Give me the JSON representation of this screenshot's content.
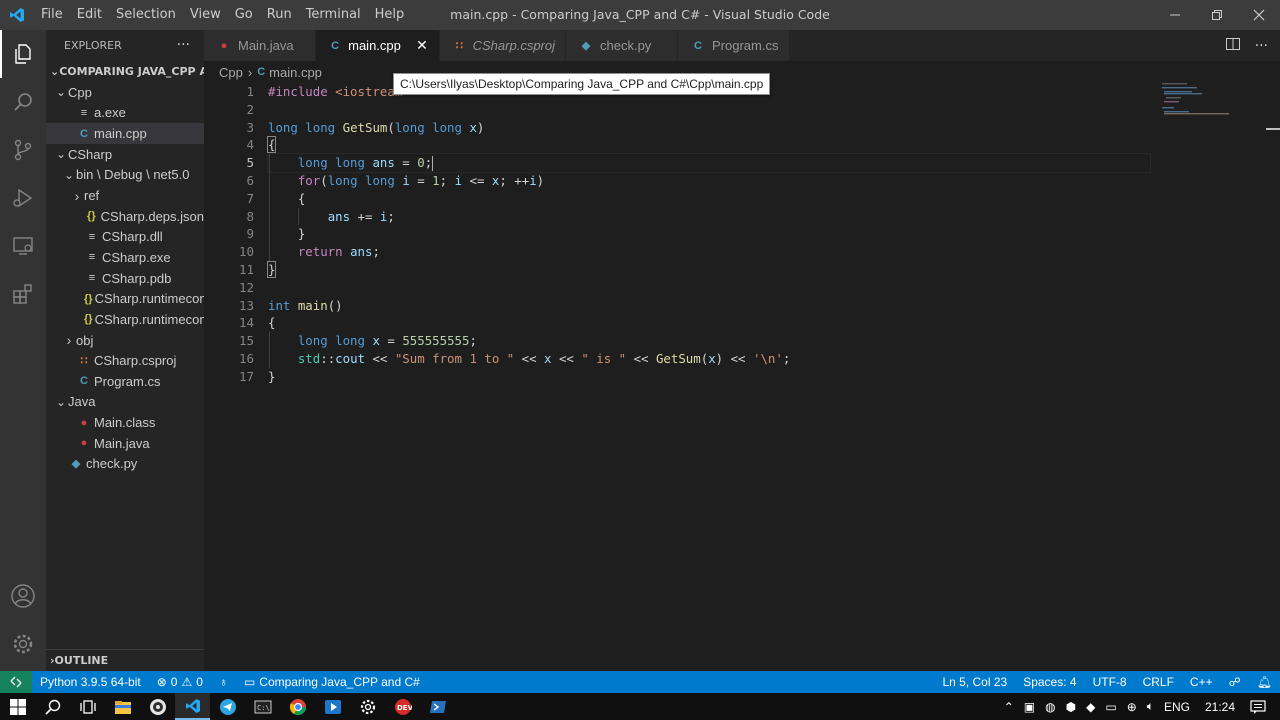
{
  "window": {
    "title": "main.cpp - Comparing Java_CPP and C# - Visual Studio Code",
    "menu": [
      "File",
      "Edit",
      "Selection",
      "View",
      "Go",
      "Run",
      "Terminal",
      "Help"
    ]
  },
  "explorer": {
    "header": "EXPLORER",
    "more_label": "···",
    "workspace": "COMPARING JAVA_CPP A...",
    "tree": [
      {
        "label": "Cpp",
        "depth": 1,
        "kind": "folder-open"
      },
      {
        "label": "a.exe",
        "depth": 2,
        "kind": "file",
        "icon": "lines"
      },
      {
        "label": "main.cpp",
        "depth": 2,
        "kind": "file",
        "icon": "cpp",
        "selected": true
      },
      {
        "label": "CSharp",
        "depth": 1,
        "kind": "folder-open"
      },
      {
        "label": "bin \\ Debug \\ net5.0",
        "depth": 2,
        "kind": "folder-open"
      },
      {
        "label": "ref",
        "depth": 3,
        "kind": "folder-closed"
      },
      {
        "label": "CSharp.deps.json",
        "depth": 3,
        "kind": "file",
        "icon": "json"
      },
      {
        "label": "CSharp.dll",
        "depth": 3,
        "kind": "file",
        "icon": "lines"
      },
      {
        "label": "CSharp.exe",
        "depth": 3,
        "kind": "file",
        "icon": "lines"
      },
      {
        "label": "CSharp.pdb",
        "depth": 3,
        "kind": "file",
        "icon": "lines"
      },
      {
        "label": "CSharp.runtimecon...",
        "depth": 3,
        "kind": "file",
        "icon": "json"
      },
      {
        "label": "CSharp.runtimecon...",
        "depth": 3,
        "kind": "file",
        "icon": "json"
      },
      {
        "label": "obj",
        "depth": 2,
        "kind": "folder-closed"
      },
      {
        "label": "CSharp.csproj",
        "depth": 2,
        "kind": "file",
        "icon": "rss"
      },
      {
        "label": "Program.cs",
        "depth": 2,
        "kind": "file",
        "icon": "cs"
      },
      {
        "label": "Java",
        "depth": 1,
        "kind": "folder-open"
      },
      {
        "label": "Main.class",
        "depth": 2,
        "kind": "file",
        "icon": "java"
      },
      {
        "label": "Main.java",
        "depth": 2,
        "kind": "file",
        "icon": "java"
      },
      {
        "label": "check.py",
        "depth": 1,
        "kind": "file",
        "icon": "py"
      }
    ],
    "outline": "OUTLINE"
  },
  "tabs": [
    {
      "label": "Main.java",
      "icon": "java"
    },
    {
      "label": "main.cpp",
      "icon": "cpp",
      "active": true,
      "close": "✕"
    },
    {
      "label": "CSharp.csproj",
      "icon": "rss",
      "italic": true
    },
    {
      "label": "check.py",
      "icon": "py"
    },
    {
      "label": "Program.cs",
      "icon": "cs"
    }
  ],
  "breadcrumb": {
    "folder": "Cpp",
    "file": "main.cpp"
  },
  "tooltip": "C:\\Users\\Ilyas\\Desktop\\Comparing Java_CPP and C#\\Cpp\\main.cpp",
  "editor": {
    "current_line": 5,
    "line_numbers": [
      "1",
      "2",
      "3",
      "4",
      "5",
      "6",
      "7",
      "8",
      "9",
      "10",
      "11",
      "12",
      "13",
      "14",
      "15",
      "16",
      "17"
    ],
    "lines": [
      [
        [
          "c",
          "#include "
        ],
        [
          "s",
          "<iostream>"
        ]
      ],
      [],
      [
        [
          "k",
          "long long "
        ],
        [
          "f",
          "GetSum"
        ],
        [
          "d",
          "("
        ],
        [
          "k",
          "long long "
        ],
        [
          "v",
          "x"
        ],
        [
          "d",
          ")"
        ]
      ],
      [
        [
          "bm",
          "{"
        ]
      ],
      [
        [
          "d",
          "    "
        ],
        [
          "k",
          "long long "
        ],
        [
          "v",
          "ans"
        ],
        [
          "d",
          " = "
        ],
        [
          "n",
          "0"
        ],
        [
          "d",
          ";"
        ],
        [
          "caret",
          ""
        ]
      ],
      [
        [
          "d",
          "    "
        ],
        [
          "c",
          "for"
        ],
        [
          "d",
          "("
        ],
        [
          "k",
          "long long "
        ],
        [
          "v",
          "i"
        ],
        [
          "d",
          " = "
        ],
        [
          "n",
          "1"
        ],
        [
          "d",
          "; "
        ],
        [
          "v",
          "i"
        ],
        [
          "d",
          " <= "
        ],
        [
          "v",
          "x"
        ],
        [
          "d",
          "; ++"
        ],
        [
          "v",
          "i"
        ],
        [
          "d",
          ")"
        ]
      ],
      [
        [
          "d",
          "    {"
        ]
      ],
      [
        [
          "d",
          "        "
        ],
        [
          "v",
          "ans"
        ],
        [
          "d",
          " += "
        ],
        [
          "v",
          "i"
        ],
        [
          "d",
          ";"
        ]
      ],
      [
        [
          "d",
          "    }"
        ]
      ],
      [
        [
          "d",
          "    "
        ],
        [
          "c",
          "return "
        ],
        [
          "v",
          "ans"
        ],
        [
          "d",
          ";"
        ]
      ],
      [
        [
          "bm",
          "}"
        ]
      ],
      [],
      [
        [
          "k",
          "int "
        ],
        [
          "f",
          "main"
        ],
        [
          "d",
          "()"
        ]
      ],
      [
        [
          "d",
          "{"
        ]
      ],
      [
        [
          "d",
          "    "
        ],
        [
          "k",
          "long long "
        ],
        [
          "v",
          "x"
        ],
        [
          "d",
          " = "
        ],
        [
          "n",
          "555555555"
        ],
        [
          "d",
          ";"
        ]
      ],
      [
        [
          "d",
          "    "
        ],
        [
          "t",
          "std"
        ],
        [
          "d",
          "::"
        ],
        [
          "v",
          "cout"
        ],
        [
          "d",
          " << "
        ],
        [
          "s",
          "\"Sum from 1 to \""
        ],
        [
          "d",
          " << "
        ],
        [
          "v",
          "x"
        ],
        [
          "d",
          " << "
        ],
        [
          "s",
          "\" is \""
        ],
        [
          "d",
          " << "
        ],
        [
          "f",
          "GetSum"
        ],
        [
          "d",
          "("
        ],
        [
          "v",
          "x"
        ],
        [
          "d",
          ") << "
        ],
        [
          "s",
          "'\\n'"
        ],
        [
          "d",
          ";"
        ]
      ],
      [
        [
          "d",
          "}"
        ]
      ]
    ]
  },
  "status": {
    "python": "Python 3.9.5 64-bit",
    "errors": "0",
    "warnings": "0",
    "folder": "Comparing Java_CPP and C#",
    "position": "Ln 5, Col 23",
    "spaces": "Spaces: 4",
    "encoding": "UTF-8",
    "eol": "CRLF",
    "language": "C++"
  },
  "taskbar": {
    "lang": "ENG",
    "time": "21:24"
  },
  "colors": {
    "accent": "#007acc",
    "remote": "#16825d",
    "java": "#cc3e44",
    "cpp": "#519aba",
    "json": "#cbcb41",
    "rss": "#e37933",
    "py": "#519aba"
  }
}
